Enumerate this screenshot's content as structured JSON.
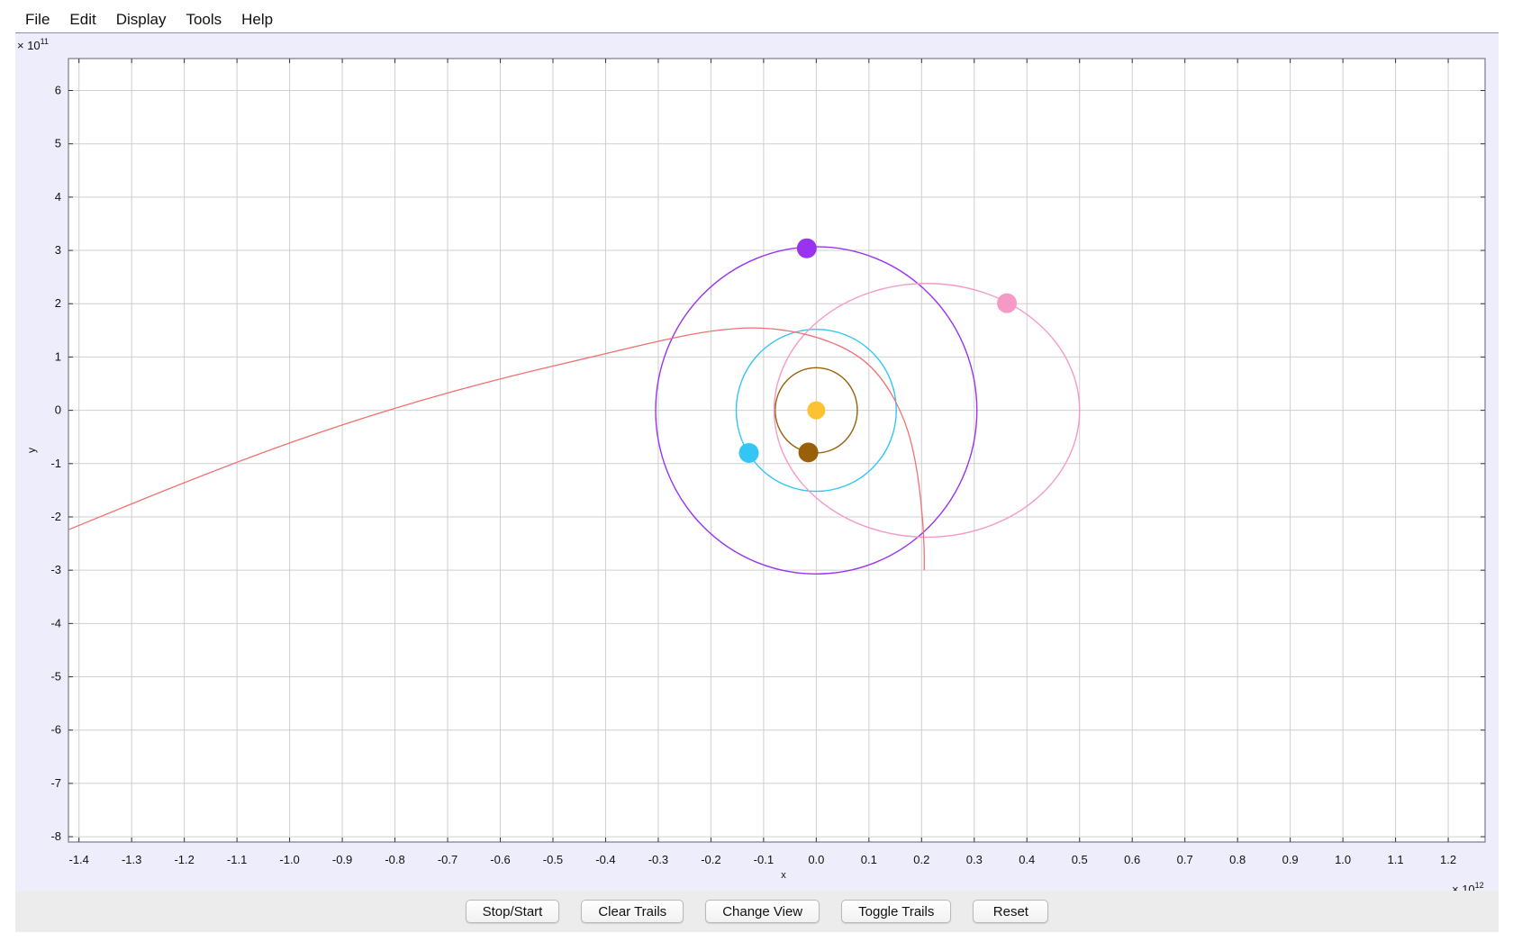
{
  "menu": [
    "File",
    "Edit",
    "Display",
    "Tools",
    "Help"
  ],
  "buttons": {
    "stop_start": "Stop/Start",
    "clear_trails": "Clear Trails",
    "change_view": "Change View",
    "toggle_trails": "Toggle Trails",
    "reset": "Reset"
  },
  "chart_data": {
    "type": "scatter",
    "xlabel": "x",
    "ylabel": "y",
    "x_multiplier": "× 10",
    "x_exponent": "12",
    "y_multiplier": "× 10",
    "y_exponent": "11",
    "xlim": [
      -1.42,
      1.27
    ],
    "ylim": [
      -8.1,
      6.6
    ],
    "x_ticks": [
      -1.4,
      -1.3,
      -1.2,
      -1.1,
      -1.0,
      -0.9,
      -0.8,
      -0.7,
      -0.6,
      -0.5,
      -0.4,
      -0.3,
      -0.2,
      -0.1,
      -0.0,
      0.1,
      0.2,
      0.3,
      0.4,
      0.5,
      0.6,
      0.7,
      0.8,
      0.9,
      1.0,
      1.1,
      1.2
    ],
    "y_ticks": [
      6,
      5,
      4,
      3,
      2,
      1,
      0,
      -1,
      -2,
      -3,
      -4,
      -5,
      -6,
      -7,
      -8
    ],
    "grid": true,
    "colors": {
      "background": "#ededfb",
      "plot_background": "#ffffff",
      "grid": "#cfcfcf",
      "sun": "#fcc233",
      "brown": "#99600a",
      "cyan": "#33c6f3",
      "purple": "#9933f0",
      "pink": "#f59ac6",
      "comet": "#f07070"
    },
    "orbits": [
      {
        "color": "brown",
        "cx": 0.0,
        "cy": 0.0,
        "rx": 0.078,
        "ry": 0.8
      },
      {
        "color": "cyan",
        "cx": 0.0,
        "cy": 0.0,
        "rx": 0.152,
        "ry": 1.52
      },
      {
        "color": "purple",
        "cx": 0.0,
        "cy": 0.0,
        "rx": 0.305,
        "ry": 3.07
      },
      {
        "color": "pink",
        "cx": 0.21,
        "cy": 0.0,
        "rx": 0.29,
        "ry": 2.38
      }
    ],
    "bodies": [
      {
        "color": "sun",
        "x": 0.0,
        "y": 0.0,
        "size": 10
      },
      {
        "color": "brown",
        "x": -0.015,
        "y": -0.79,
        "size": 11
      },
      {
        "color": "cyan",
        "x": -0.128,
        "y": -0.8,
        "size": 11
      },
      {
        "color": "purple",
        "x": -0.018,
        "y": 3.04,
        "size": 11
      },
      {
        "color": "pink",
        "x": 0.362,
        "y": 2.01,
        "size": 11
      }
    ],
    "comet_trail": {
      "color": "comet",
      "points": [
        [
          -1.42,
          -2.24
        ],
        [
          -1.2,
          -1.35
        ],
        [
          -1.0,
          -0.6
        ],
        [
          -0.8,
          0.05
        ],
        [
          -0.6,
          0.6
        ],
        [
          -0.4,
          1.06
        ],
        [
          -0.3,
          1.3
        ],
        [
          -0.2,
          1.5
        ],
        [
          -0.1,
          1.57
        ],
        [
          0.0,
          1.4
        ],
        [
          0.08,
          1.05
        ],
        [
          0.13,
          0.55
        ],
        [
          0.17,
          -0.2
        ],
        [
          0.19,
          -1.0
        ],
        [
          0.2,
          -1.8
        ],
        [
          0.205,
          -2.5
        ],
        [
          0.205,
          -3.0
        ]
      ]
    }
  }
}
